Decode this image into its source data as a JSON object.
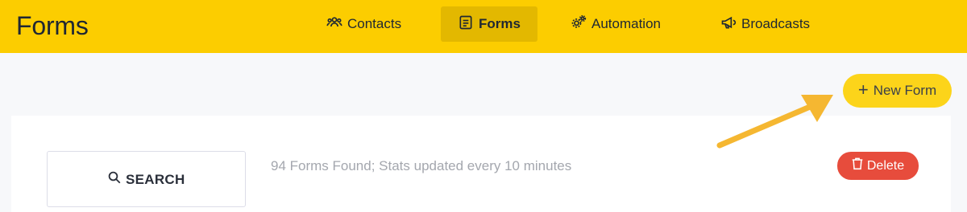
{
  "app": {
    "title": "Forms"
  },
  "nav": {
    "items": [
      {
        "label": "Contacts",
        "icon": "users-icon",
        "active": false
      },
      {
        "label": "Forms",
        "icon": "form-icon",
        "active": true
      },
      {
        "label": "Automation",
        "icon": "gears-icon",
        "active": false
      },
      {
        "label": "Broadcasts",
        "icon": "megaphone-icon",
        "active": false
      }
    ]
  },
  "toolbar": {
    "new_form_label": "New Form",
    "new_form_icon": "plus-icon"
  },
  "search": {
    "label": "SEARCH",
    "icon": "search-icon"
  },
  "list": {
    "status": "94 Forms Found; Stats updated every 10 minutes"
  },
  "actions": {
    "delete_label": "Delete",
    "delete_icon": "trash-icon"
  },
  "colors": {
    "header": "#fccd00",
    "nav_active": "#e3b800",
    "new_button": "#fcd41a",
    "delete": "#e74c3c",
    "annotation_arrow": "#f5b731"
  }
}
